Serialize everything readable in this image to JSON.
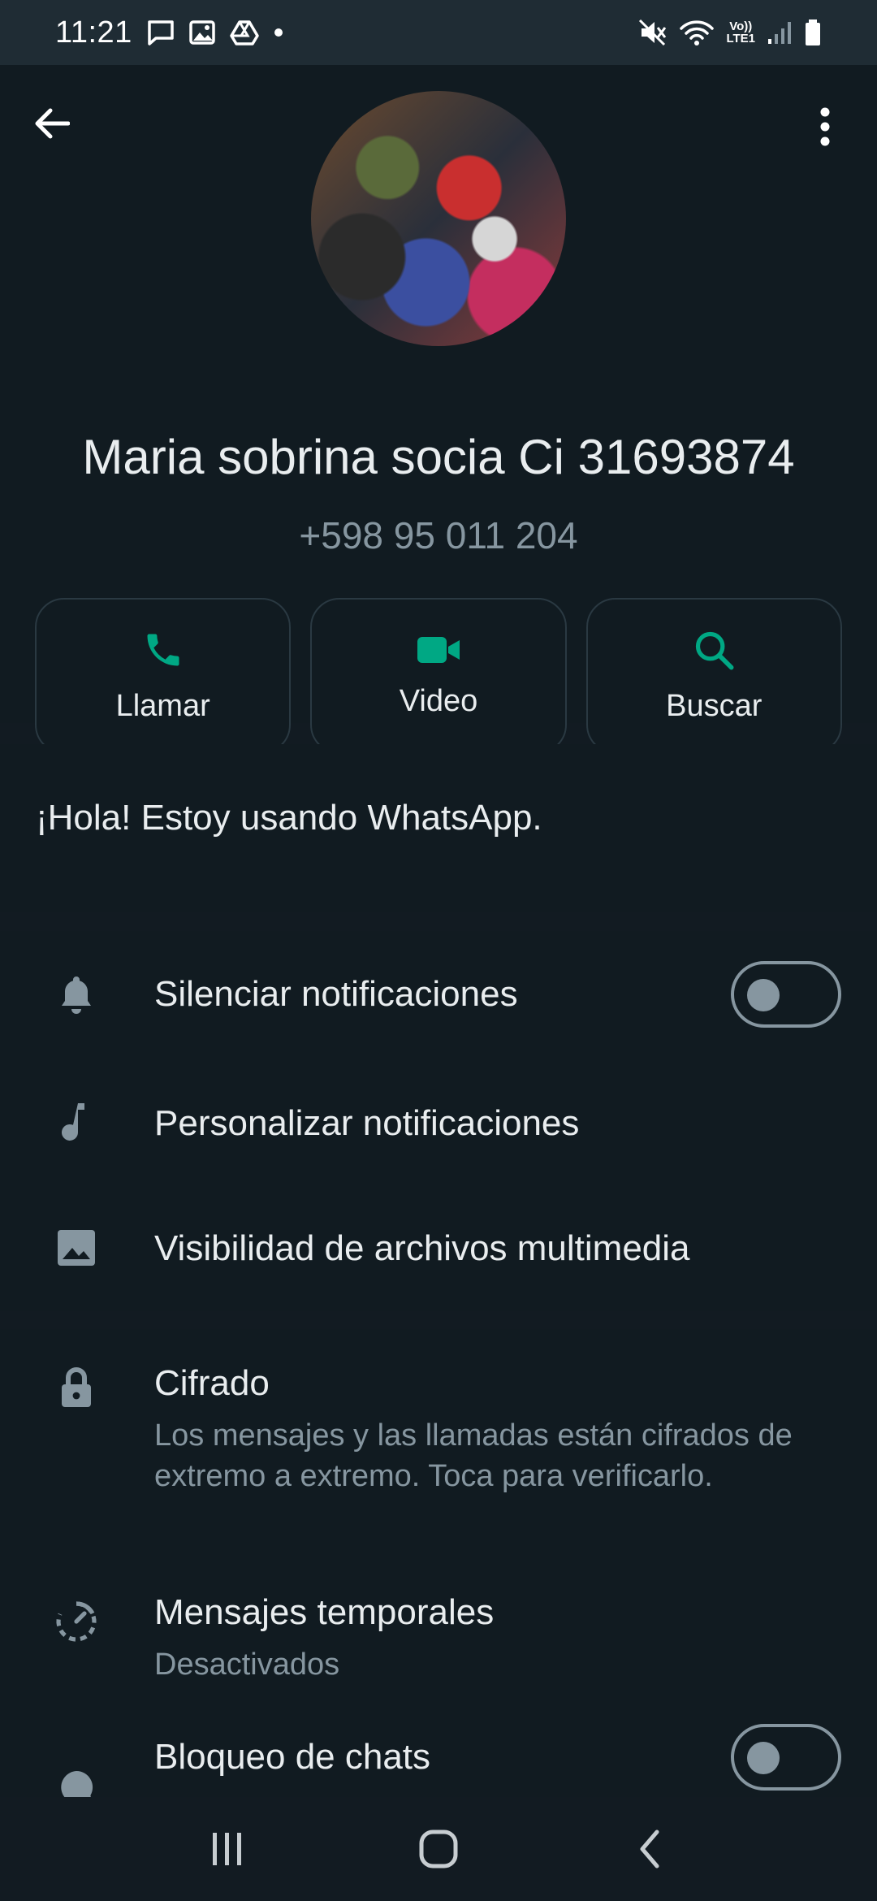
{
  "status_bar": {
    "time": "11:21",
    "volte_top": "Vo))",
    "volte_bottom": "LTE1"
  },
  "contact": {
    "name": "Maria sobrina socia Ci 31693874",
    "phone": "+598 95 011 204"
  },
  "actions": [
    {
      "label": "Llamar",
      "icon": "phone-icon"
    },
    {
      "label": "Video",
      "icon": "video-icon"
    },
    {
      "label": "Buscar",
      "icon": "search-icon"
    }
  ],
  "about": "¡Hola! Estoy usando WhatsApp.",
  "settings": {
    "mute": {
      "label": "Silenciar notificaciones",
      "enabled": false
    },
    "custom": {
      "label": "Personalizar notificaciones"
    },
    "media": {
      "label": "Visibilidad de archivos multimedia"
    }
  },
  "privacy": {
    "encryption": {
      "label": "Cifrado",
      "description": "Los mensajes y las llamadas están cifrados de extremo a extremo. Toca para verificarlo."
    },
    "disappearing": {
      "label": "Mensajes temporales",
      "status": "Desactivados"
    },
    "chat_lock": {
      "label": "Bloqueo de chats",
      "enabled": false
    }
  },
  "colors": {
    "accent": "#00a884",
    "background": "#111b21",
    "text": "#e9edef",
    "muted": "#8696a0"
  }
}
